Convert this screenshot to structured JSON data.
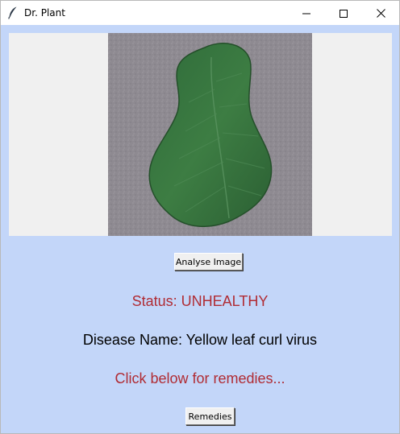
{
  "window": {
    "title": "Dr. Plant",
    "icon": "feather-icon",
    "controls": {
      "minimize": "minimize-icon",
      "maximize": "maximize-icon",
      "close": "close-icon"
    }
  },
  "image": {
    "description_icon": "leaf-photo",
    "panel_color": "#f0f0f0"
  },
  "actions": {
    "analyse_label": "Analyse Image",
    "remedies_label": "Remedies"
  },
  "results": {
    "status_text": "Status: UNHEALTHY",
    "disease_text": "Disease Name: Yellow leaf curl virus",
    "hint_text": "Click below for remedies..."
  },
  "colors": {
    "background": "#c3d6f9",
    "status": "#b02c34",
    "disease": "#000000",
    "hint": "#b02c34"
  }
}
